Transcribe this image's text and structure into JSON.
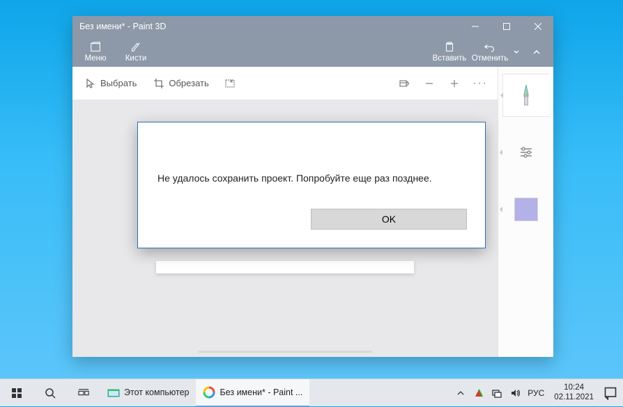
{
  "window": {
    "title": "Без имени* - Paint 3D"
  },
  "ribbon": {
    "menu": "Меню",
    "brushes": "Кисти",
    "paste": "Вставить",
    "undo": "Отменить"
  },
  "toolbar": {
    "select": "Выбрать",
    "crop": "Обрезать"
  },
  "dialog": {
    "message": "Не удалось сохранить проект. Попробуйте еще раз позднее.",
    "ok": "OK"
  },
  "side": {
    "color": "#b4b0e8"
  },
  "taskbar": {
    "items": [
      {
        "label": "Этот компьютер"
      },
      {
        "label": "Без имени* - Paint ..."
      }
    ],
    "lang": "РУС",
    "time": "10:24",
    "date": "02.11.2021"
  }
}
